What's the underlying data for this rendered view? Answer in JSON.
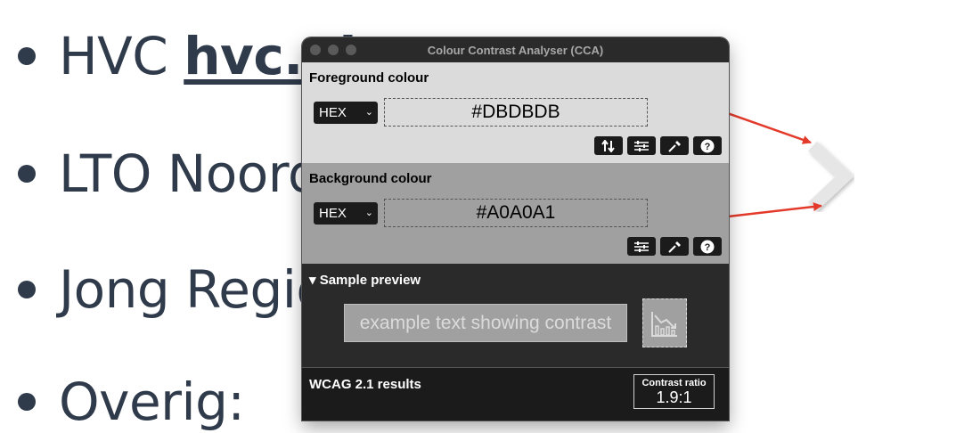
{
  "slide": {
    "items": [
      {
        "prefix": "HVC ",
        "link": "hvc.nl"
      },
      {
        "prefix": "LTO Noord",
        "link": ""
      },
      {
        "prefix": "Jong Regio",
        "link": ""
      },
      {
        "prefix": "Overig:",
        "link": ""
      }
    ]
  },
  "window": {
    "title": "Colour Contrast Analyser (CCA)"
  },
  "foreground": {
    "heading": "Foreground colour",
    "format": "HEX",
    "value": "#DBDBDB",
    "color": "#DBDBDB"
  },
  "background": {
    "heading": "Background colour",
    "format": "HEX",
    "value": "#A0A0A1",
    "color": "#A0A0A1"
  },
  "preview": {
    "heading": "▾ Sample preview",
    "sample_text": "example text showing contrast"
  },
  "results": {
    "heading": "WCAG 2.1 results",
    "ratio_label": "Contrast ratio",
    "ratio_value": "1.9:1"
  },
  "colors": {
    "arrow": "#e33a2b",
    "slide_text": "#2f3a4b"
  }
}
